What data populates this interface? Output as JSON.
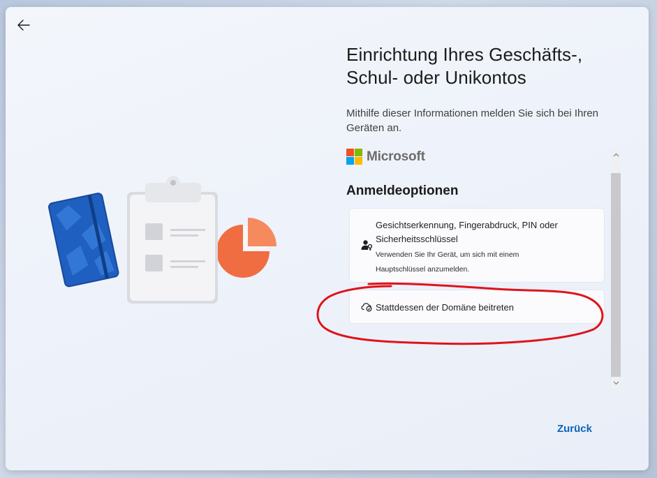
{
  "header": {
    "title_line1": "Einrichtung Ihres Geschäfts-,",
    "title_line2": "Schul- oder Unikontos",
    "subtitle": "Mithilfe dieser Informationen melden Sie sich bei Ihren Geräten an."
  },
  "brand": {
    "name": "Microsoft",
    "colors": [
      "#f25022",
      "#7fba00",
      "#00a4ef",
      "#ffb900"
    ]
  },
  "section": {
    "title": "Anmeldeoptionen"
  },
  "options": [
    {
      "icon": "person-key-icon",
      "title": "Gesichtserkennung, Fingerabdruck, PIN oder Sicherheitsschlüssel",
      "description": "Verwenden Sie Ihr Gerät, um sich mit einem Hauptschlüssel anzumelden."
    },
    {
      "icon": "cloud-sync-icon",
      "title": "Stattdessen der Domäne beitreten"
    }
  ],
  "footer": {
    "back_label": "Zurück"
  },
  "colors": {
    "accent": "#0a63b8",
    "annotation": "#e0121b"
  }
}
